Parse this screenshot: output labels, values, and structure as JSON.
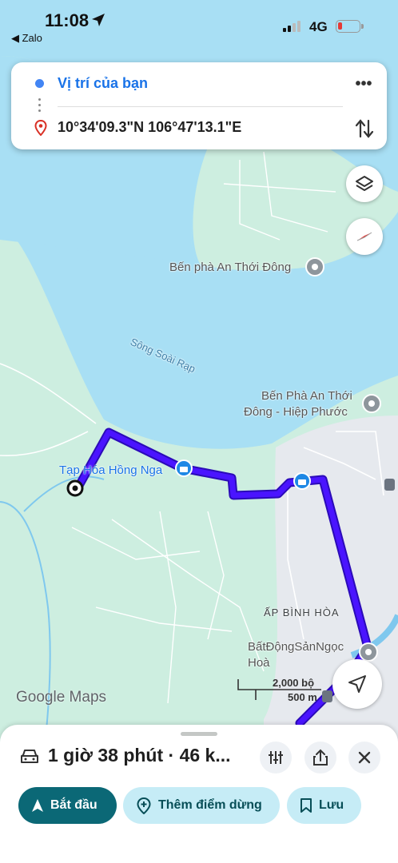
{
  "status_bar": {
    "time": "11:08",
    "back_app": "◀ Zalo",
    "network": "4G"
  },
  "directions": {
    "origin": "Vị trí của bạn",
    "destination": "10°34'09.3\"N 106°47'13.1\"E",
    "more_icon": "more-vert-icon",
    "swap_icon": "swap-icon"
  },
  "map": {
    "labels": {
      "ferry1": "Bến phà An Thới Đông",
      "river": "Sông Soài Rạp",
      "ferry2_line1": "Bến Phà An Thới",
      "ferry2_line2": "Đông - Hiệp Phước",
      "shop": "Tạp Hóa Hồng Nga",
      "village": "ẤP BÌNH HÒA",
      "realestate_line1": "BấtĐộngSảnNgọc",
      "realestate_line2": "Hoà"
    },
    "watermark": "Google Maps",
    "scale": {
      "top": "2,000 bộ",
      "bottom": "500 m"
    },
    "colors": {
      "water": "#a8dff4",
      "land": "#cdeee0",
      "route": "#4a14ff"
    }
  },
  "sheet": {
    "route_summary": "1 giờ 38 phút · 46 k...",
    "start_label": "Bắt đầu",
    "add_stop_label": "Thêm điểm dừng",
    "save_label": "Lưu"
  }
}
